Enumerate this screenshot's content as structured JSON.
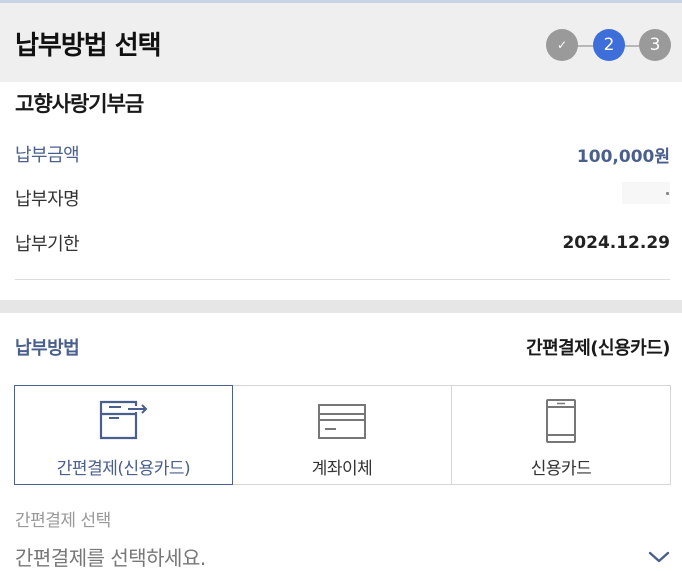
{
  "header": {
    "title": "납부방법 선택",
    "steps": [
      {
        "label": "✓",
        "state": "done"
      },
      {
        "label": "2",
        "state": "current"
      },
      {
        "label": "3",
        "state": "pending"
      }
    ]
  },
  "summary": {
    "title": "고향사랑기부금",
    "rows": [
      {
        "label": "납부금액",
        "value": "100,000원"
      },
      {
        "label": "납부자명",
        "value": ""
      },
      {
        "label": "납부기한",
        "value": "2024.12.29"
      }
    ]
  },
  "payment": {
    "label": "납부방법",
    "selected_value": "간편결제(신용카드)",
    "options": [
      {
        "label": "간편결제(신용카드)",
        "icon": "easy-pay-icon",
        "selected": true
      },
      {
        "label": "계좌이체",
        "icon": "bank-transfer-icon",
        "selected": false
      },
      {
        "label": "신용카드",
        "icon": "mobile-card-icon",
        "selected": false
      }
    ]
  },
  "easy_pay": {
    "label": "간편결제 선택",
    "placeholder": "간편결제를 선택하세요."
  },
  "colors": {
    "accent": "#4a5f8d",
    "step_active": "#3d6ed9",
    "step_inactive": "#9a9a9a",
    "header_bg": "#efefef"
  }
}
